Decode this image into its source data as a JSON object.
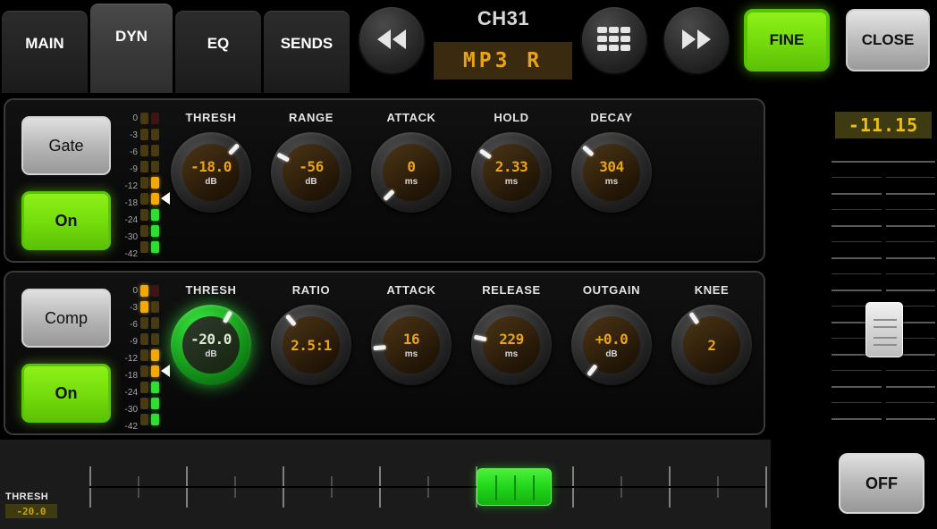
{
  "header": {
    "tabs": [
      {
        "label": "MAIN",
        "active": false
      },
      {
        "label": "DYN",
        "active": true
      },
      {
        "label": "EQ",
        "active": false
      },
      {
        "label": "SENDS",
        "active": false
      }
    ],
    "prev_icon": "rewind-icon",
    "grid_icon": "grid-icon",
    "next_icon": "fast-forward-icon",
    "channel_title": "CH31",
    "channel_name": "MP3 R",
    "fine_label": "FINE",
    "close_label": "CLOSE"
  },
  "colors": {
    "accent_green": "#74dd0c",
    "led_amber": "#e8a317",
    "meter_green": "#2ee02e",
    "meter_amber": "#f5a800",
    "display_bg": "#3a2a10"
  },
  "meter_scale": [
    "0",
    "-3",
    "-6",
    "-9",
    "-12",
    "-18",
    "-24",
    "-30",
    "-42"
  ],
  "gate": {
    "name_label": "Gate",
    "on_label": "On",
    "on_state": true,
    "meter_pointer_index": 5,
    "meter_left": [
      "off-amber",
      "off-amber",
      "off-amber",
      "off-amber",
      "off-amber",
      "off-amber",
      "off-amber",
      "off-amber",
      "off-amber"
    ],
    "meter_right": [
      "off-red",
      "off-amber",
      "off-amber",
      "off-amber",
      "amber",
      "amber",
      "green",
      "green",
      "green"
    ],
    "knobs": [
      {
        "label": "THRESH",
        "value": "-18.0",
        "unit": "dB",
        "angle": 44,
        "selected": false
      },
      {
        "label": "RANGE",
        "value": "-56",
        "unit": "dB",
        "angle": -62,
        "selected": false
      },
      {
        "label": "ATTACK",
        "value": "0",
        "unit": "ms",
        "angle": -135,
        "selected": false
      },
      {
        "label": "HOLD",
        "value": "2.33",
        "unit": "ms",
        "angle": -55,
        "selected": false
      },
      {
        "label": "DECAY",
        "value": "304",
        "unit": "ms",
        "angle": -48,
        "selected": false
      }
    ]
  },
  "comp": {
    "name_label": "Comp",
    "on_label": "On",
    "on_state": true,
    "meter_pointer_index": 5,
    "meter_left": [
      "amber",
      "amber",
      "off-amber",
      "off-amber",
      "off-amber",
      "off-amber",
      "off-amber",
      "off-amber",
      "off-amber"
    ],
    "meter_right": [
      "off-red",
      "off-amber",
      "off-amber",
      "off-amber",
      "amber",
      "amber",
      "green",
      "green",
      "green"
    ],
    "knobs": [
      {
        "label": "THRESH",
        "value": "-20.0",
        "unit": "dB",
        "angle": 30,
        "selected": true
      },
      {
        "label": "RATIO",
        "value": "2.5:1",
        "unit": "",
        "angle": -40,
        "selected": false
      },
      {
        "label": "ATTACK",
        "value": "16",
        "unit": "ms",
        "angle": -95,
        "selected": false
      },
      {
        "label": "RELEASE",
        "value": "229",
        "unit": "ms",
        "angle": -78,
        "selected": false
      },
      {
        "label": "OUTGAIN",
        "value": "+0.0",
        "unit": "dB",
        "angle": -142,
        "selected": false
      },
      {
        "label": "KNEE",
        "value": "2",
        "unit": "",
        "angle": -34,
        "selected": false
      }
    ]
  },
  "fader": {
    "value": "-11.15",
    "off_label": "OFF"
  },
  "bottom": {
    "thresh_label": "THRESH",
    "thresh_value": "-20.0"
  }
}
